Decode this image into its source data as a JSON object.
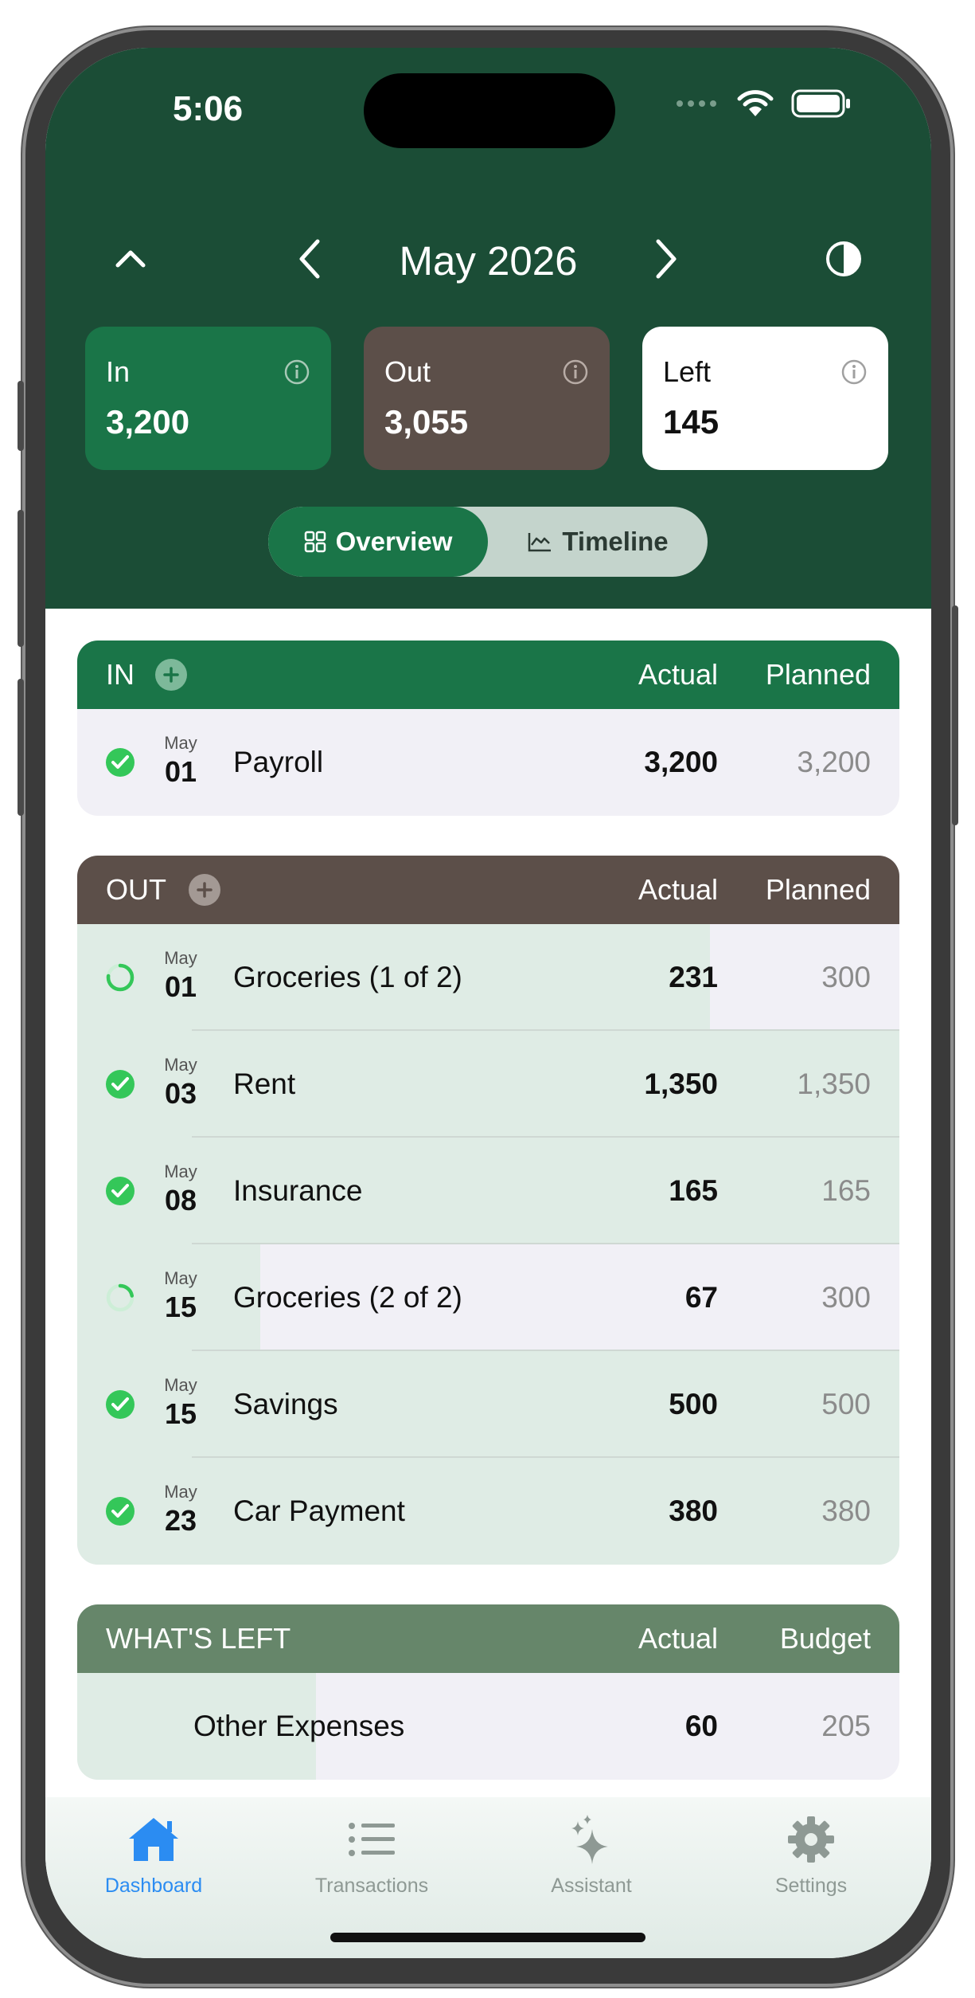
{
  "status_bar": {
    "time": "5:06"
  },
  "header": {
    "month_title": "May 2026",
    "summary": [
      {
        "label": "In",
        "value": "3,200"
      },
      {
        "label": "Out",
        "value": "3,055"
      },
      {
        "label": "Left",
        "value": "145"
      }
    ],
    "segmented": {
      "overview": "Overview",
      "timeline": "Timeline",
      "selected": "Overview"
    }
  },
  "colors": {
    "header_bg": "#1b4d36",
    "in_green": "#1a7548",
    "out_brown": "#5c4f49",
    "whats_left_green": "#66866a",
    "progress_fill": "#dfece5",
    "done_check": "#34c759",
    "tab_active": "#2b8cf2"
  },
  "in_section": {
    "title": "IN",
    "col_actual": "Actual",
    "col_planned": "Planned",
    "rows": [
      {
        "status": "done",
        "month": "May",
        "day": "01",
        "name": "Payroll",
        "actual": "3,200",
        "planned": "3,200",
        "progress": 0
      }
    ]
  },
  "out_section": {
    "title": "OUT",
    "col_actual": "Actual",
    "col_planned": "Planned",
    "rows": [
      {
        "status": "partial",
        "month": "May",
        "day": "01",
        "name": "Groceries (1 of 2)",
        "actual": "231",
        "planned": "300",
        "progress": 0.77
      },
      {
        "status": "done",
        "month": "May",
        "day": "03",
        "name": "Rent",
        "actual": "1,350",
        "planned": "1,350",
        "progress": 1
      },
      {
        "status": "done",
        "month": "May",
        "day": "08",
        "name": "Insurance",
        "actual": "165",
        "planned": "165",
        "progress": 1
      },
      {
        "status": "partial",
        "month": "May",
        "day": "15",
        "name": "Groceries (2 of 2)",
        "actual": "67",
        "planned": "300",
        "progress": 0.223
      },
      {
        "status": "done",
        "month": "May",
        "day": "15",
        "name": "Savings",
        "actual": "500",
        "planned": "500",
        "progress": 1
      },
      {
        "status": "done",
        "month": "May",
        "day": "23",
        "name": "Car Payment",
        "actual": "380",
        "planned": "380",
        "progress": 1
      }
    ]
  },
  "whats_left_section": {
    "title": "WHAT'S LEFT",
    "col_actual": "Actual",
    "col_budget": "Budget",
    "rows": [
      {
        "name": "Other Expenses",
        "actual": "60",
        "budget": "205",
        "progress": 0.29
      }
    ]
  },
  "tab_bar": {
    "tabs": [
      {
        "label": "Dashboard",
        "icon": "house-icon",
        "active": true
      },
      {
        "label": "Transactions",
        "icon": "list-icon",
        "active": false
      },
      {
        "label": "Assistant",
        "icon": "sparkles-icon",
        "active": false
      },
      {
        "label": "Settings",
        "icon": "gear-icon",
        "active": false
      }
    ]
  }
}
